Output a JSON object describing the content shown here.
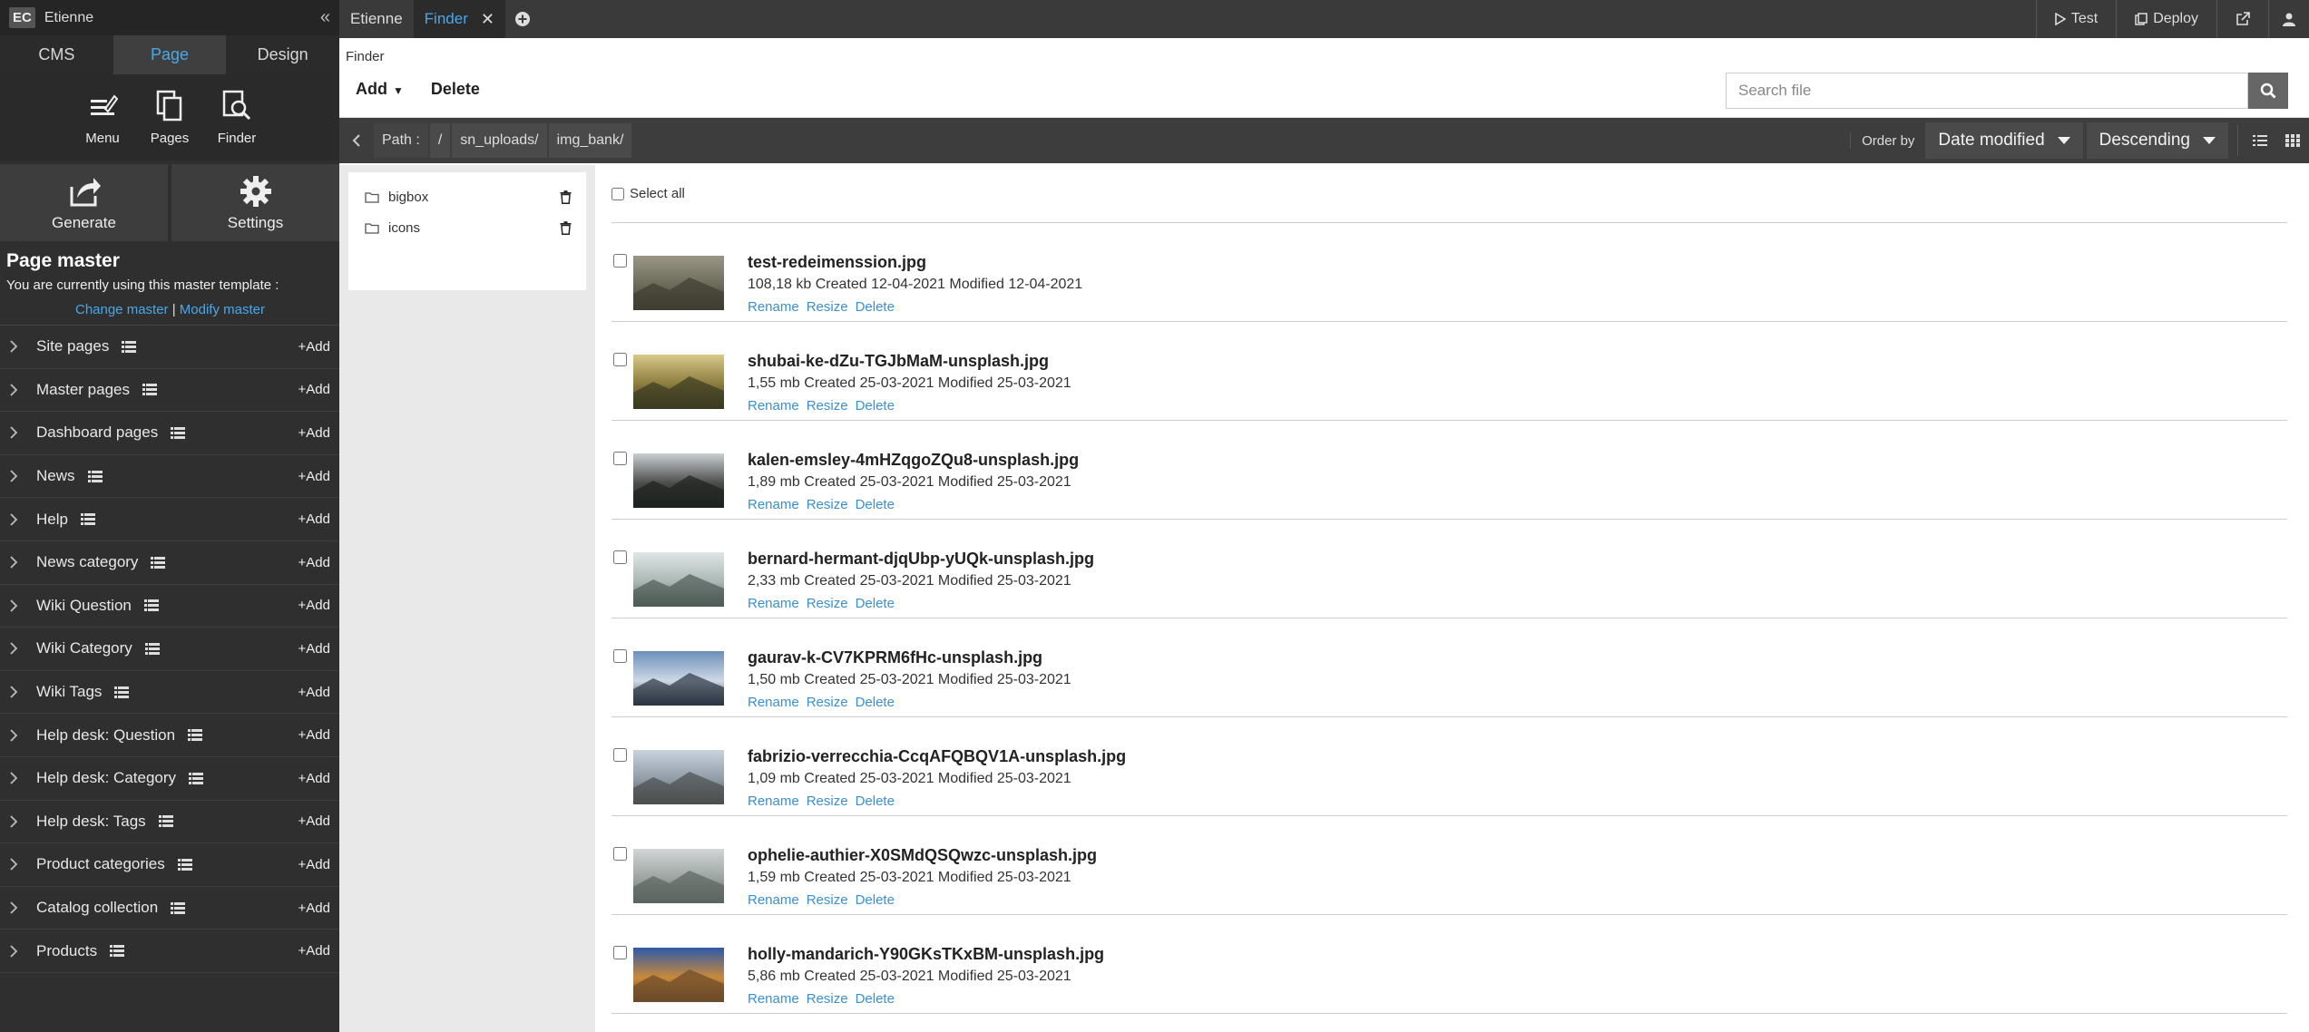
{
  "sidebar": {
    "workspace_badge": "EC",
    "user_name": "Etienne",
    "collapse_icon": "«",
    "tabs": [
      "CMS",
      "Page",
      "Design"
    ],
    "tools": [
      {
        "label": "Menu",
        "icon": "menu-edit-icon"
      },
      {
        "label": "Pages",
        "icon": "pages-icon"
      },
      {
        "label": "Finder",
        "icon": "finder-icon"
      }
    ],
    "big_tools": [
      {
        "label": "Generate",
        "icon": "generate-icon"
      },
      {
        "label": "Settings",
        "icon": "gear-icon"
      }
    ],
    "page_master": {
      "title": "Page master",
      "subtitle": "You are currently using this master template :",
      "change_link": "Change master",
      "separator": "|",
      "modify_link": "Modify master"
    },
    "add_label": "+Add",
    "items": [
      {
        "label": "Site pages"
      },
      {
        "label": "Master pages"
      },
      {
        "label": "Dashboard pages"
      },
      {
        "label": "News"
      },
      {
        "label": "Help"
      },
      {
        "label": "News category"
      },
      {
        "label": "Wiki Question"
      },
      {
        "label": "Wiki Category"
      },
      {
        "label": "Wiki Tags"
      },
      {
        "label": "Help desk: Question"
      },
      {
        "label": "Help desk: Category"
      },
      {
        "label": "Help desk: Tags"
      },
      {
        "label": "Product categories"
      },
      {
        "label": "Catalog collection"
      },
      {
        "label": "Products"
      }
    ]
  },
  "topbar": {
    "tabs": [
      {
        "label": "Etienne",
        "active": false
      },
      {
        "label": "Finder",
        "active": true
      }
    ],
    "test_label": "Test",
    "deploy_label": "Deploy"
  },
  "finder": {
    "title": "Finder",
    "add_label": "Add",
    "delete_label": "Delete",
    "search_placeholder": "Search file",
    "path_label": "Path :",
    "path_segments": [
      "/",
      "sn_uploads/",
      "img_bank/"
    ],
    "order_by_label": "Order by",
    "order_field": "Date modified",
    "order_direction": "Descending",
    "select_all_label": "Select all",
    "folders": [
      "bigbox",
      "icons"
    ],
    "action_labels": {
      "rename": "Rename",
      "resize": "Resize",
      "delete": "Delete"
    },
    "files": [
      {
        "name": "test-redeimenssion.jpg",
        "size": "108,18 kb",
        "created": "12-04-2021",
        "modified": "12-04-2021",
        "thumb_colors": [
          "#9a9686",
          "#6b6a58",
          "#3f3d30"
        ]
      },
      {
        "name": "shubai-ke-dZu-TGJbMaM-unsplash.jpg",
        "size": "1,55 mb",
        "created": "25-03-2021",
        "modified": "25-03-2021",
        "thumb_colors": [
          "#d8c98a",
          "#8a7a3c",
          "#3b3a22"
        ]
      },
      {
        "name": "kalen-emsley-4mHZqgoZQu8-unsplash.jpg",
        "size": "1,89 mb",
        "created": "25-03-2021",
        "modified": "25-03-2021",
        "thumb_colors": [
          "#c9cfd2",
          "#4b4d4a",
          "#1e2220"
        ]
      },
      {
        "name": "bernard-hermant-djqUbp-yUQk-unsplash.jpg",
        "size": "2,33 mb",
        "created": "25-03-2021",
        "modified": "25-03-2021",
        "thumb_colors": [
          "#dfe6e5",
          "#a9b7b5",
          "#4f5b55"
        ]
      },
      {
        "name": "gaurav-k-CV7KPRM6fHc-unsplash.jpg",
        "size": "1,50 mb",
        "created": "25-03-2021",
        "modified": "25-03-2021",
        "thumb_colors": [
          "#6c8fb8",
          "#cfd9e6",
          "#2b3442"
        ]
      },
      {
        "name": "fabrizio-verrecchia-CcqAFQBQV1A-unsplash.jpg",
        "size": "1,09 mb",
        "created": "25-03-2021",
        "modified": "25-03-2021",
        "thumb_colors": [
          "#c8d3e0",
          "#8f9aa4",
          "#4b4e4e"
        ]
      },
      {
        "name": "ophelie-authier-X0SMdQSQwzc-unsplash.jpg",
        "size": "1,59 mb",
        "created": "25-03-2021",
        "modified": "25-03-2021",
        "thumb_colors": [
          "#d2d6d6",
          "#9ba3a0",
          "#5b6460"
        ]
      },
      {
        "name": "holly-mandarich-Y90GKsTKxBM-unsplash.jpg",
        "size": "5,86 mb",
        "created": "25-03-2021",
        "modified": "25-03-2021",
        "thumb_colors": [
          "#2e5aa8",
          "#c9893a",
          "#6b4a2a"
        ]
      }
    ]
  },
  "colors": {
    "accent": "#4aa8e8",
    "link": "#3a8fd0",
    "sidebar_bg": "#2f2f2f",
    "bar_bg": "#3d3d3d"
  }
}
